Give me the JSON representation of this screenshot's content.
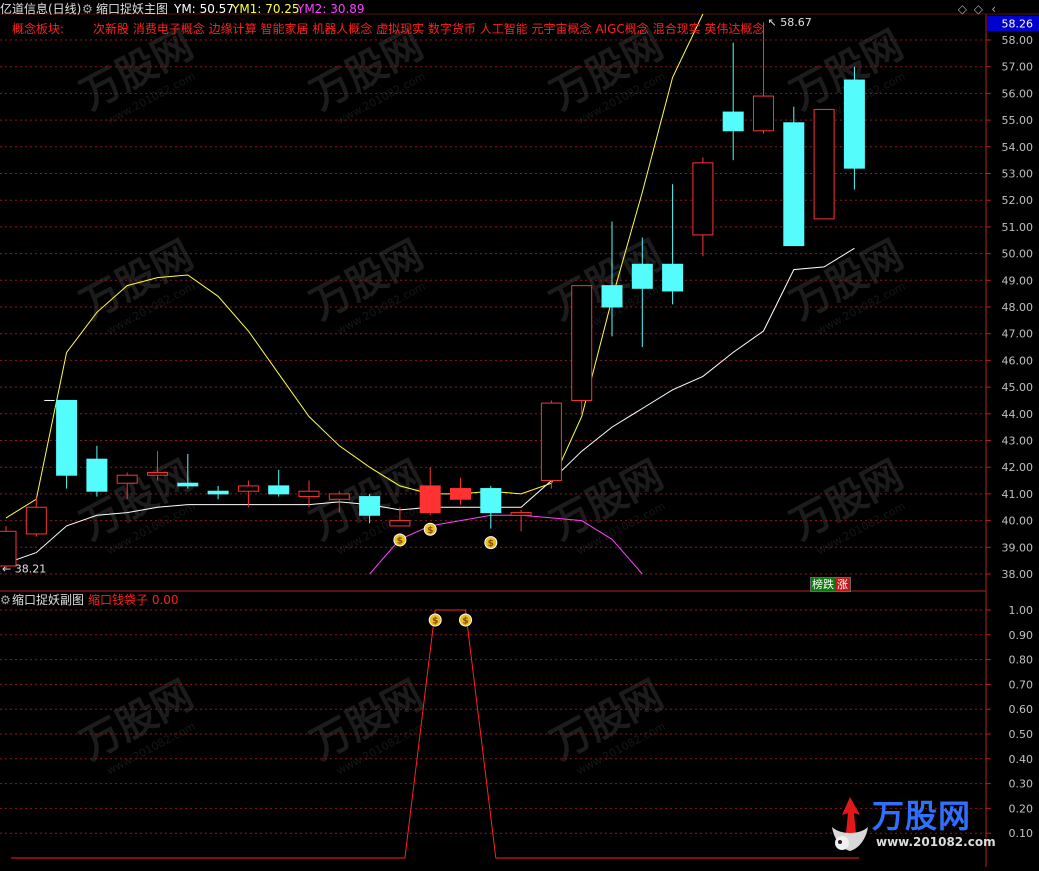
{
  "header": {
    "stock_name": "亿道信息(日线)",
    "main_indicator": "缩口捉妖主图",
    "ym_label": "YM:",
    "ym_value": "50.57",
    "ym1_label": "YM1:",
    "ym1_value": "70.25",
    "ym2_label": "YM2:",
    "ym2_value": "30.89",
    "concept_label": "概念板块:",
    "concepts": "次新股 消费电子概念 边缘计算 智能家居 机器人概念 虚拟现实 数字货币 人工智能 元宇宙概念 AIGC概念 混合现实 英伟达概念"
  },
  "sub_header": {
    "indicator": "缩口捉妖副图",
    "series_label": "缩口钱袋子",
    "series_value": "0.00"
  },
  "badge": {
    "left": "榜跌",
    "right": "涨"
  },
  "watermark": {
    "brand": "万股网",
    "url": "www.201082.com"
  },
  "colors": {
    "background": "#000000",
    "up": "#ff3232",
    "down": "#54fcfc",
    "ym": "#ffffff",
    "ym1": "#ffff40",
    "ym2": "#ff40ff",
    "grid": "#8b1a1a",
    "axis_text": "#c0c0c0",
    "current_price_box": "#0000cc"
  },
  "chart_data": [
    {
      "type": "candlestick",
      "title": "缩口捉妖主图",
      "y_ticks": [
        38,
        39,
        40,
        41,
        42,
        43,
        44,
        45,
        46,
        47,
        48,
        49,
        50,
        51,
        52,
        53,
        54,
        55,
        56,
        57,
        58
      ],
      "ylim": [
        37.6,
        58.6
      ],
      "current_price": "58.26",
      "max_label": "58.67",
      "min_label": "38.21",
      "candles": [
        {
          "o": 38.3,
          "c": 39.6,
          "h": 39.8,
          "l": 38.2
        },
        {
          "o": 39.5,
          "c": 40.5,
          "h": 40.9,
          "l": 39.4
        },
        {
          "o": 44.5,
          "c": 41.7,
          "h": 44.5,
          "l": 41.2
        },
        {
          "o": 42.3,
          "c": 41.1,
          "h": 42.8,
          "l": 40.9
        },
        {
          "o": 41.4,
          "c": 41.7,
          "h": 41.8,
          "l": 40.8
        },
        {
          "o": 41.7,
          "c": 41.8,
          "h": 42.6,
          "l": 41.5
        },
        {
          "o": 41.4,
          "c": 41.3,
          "h": 42.5,
          "l": 41.2
        },
        {
          "o": 41.1,
          "c": 41.0,
          "h": 41.3,
          "l": 40.8
        },
        {
          "o": 41.1,
          "c": 41.3,
          "h": 41.5,
          "l": 40.5
        },
        {
          "o": 41.3,
          "c": 41.0,
          "h": 41.9,
          "l": 40.9
        },
        {
          "o": 40.9,
          "c": 41.1,
          "h": 41.5,
          "l": 40.5
        },
        {
          "o": 40.8,
          "c": 41.0,
          "h": 41.1,
          "l": 40.3
        },
        {
          "o": 40.9,
          "c": 40.2,
          "h": 41.0,
          "l": 39.9
        },
        {
          "o": 39.8,
          "c": 40.0,
          "h": 40.5,
          "l": 39.8
        },
        {
          "o": 40.3,
          "c": 41.3,
          "h": 42.0,
          "l": 40.2
        },
        {
          "o": 40.8,
          "c": 41.2,
          "h": 41.6,
          "l": 40.6
        },
        {
          "o": 41.2,
          "c": 40.3,
          "h": 41.3,
          "l": 39.7
        },
        {
          "o": 40.2,
          "c": 40.3,
          "h": 40.4,
          "l": 39.6
        },
        {
          "o": 41.5,
          "c": 44.4,
          "h": 44.5,
          "l": 41.2
        },
        {
          "o": 44.5,
          "c": 48.8,
          "h": 48.8,
          "l": 44.0
        },
        {
          "o": 48.8,
          "c": 48.0,
          "h": 51.2,
          "l": 46.9
        },
        {
          "o": 49.6,
          "c": 48.7,
          "h": 50.6,
          "l": 46.5
        },
        {
          "o": 49.6,
          "c": 48.6,
          "h": 52.6,
          "l": 48.1
        },
        {
          "o": 50.7,
          "c": 53.4,
          "h": 53.6,
          "l": 49.9
        },
        {
          "o": 55.3,
          "c": 54.6,
          "h": 57.9,
          "l": 53.5
        },
        {
          "o": 54.6,
          "c": 55.9,
          "h": 58.67,
          "l": 54.5
        },
        {
          "o": 54.9,
          "c": 50.3,
          "h": 55.5,
          "l": 50.3
        },
        {
          "o": 51.3,
          "c": 55.4,
          "h": 55.4,
          "l": 51.3
        },
        {
          "o": 56.5,
          "c": 53.2,
          "h": 57.0,
          "l": 52.4
        }
      ],
      "lines": {
        "YM": [
          38.4,
          38.8,
          39.8,
          40.2,
          40.3,
          40.5,
          40.6,
          40.6,
          40.6,
          40.6,
          40.6,
          40.7,
          40.6,
          40.4,
          40.5,
          40.5,
          40.5,
          40.5,
          41.5,
          42.6,
          43.5,
          44.2,
          44.9,
          45.4,
          46.3,
          47.1,
          49.4,
          49.5,
          50.2
        ],
        "YM1": [
          40.1,
          40.8,
          46.3,
          47.8,
          48.8,
          49.1,
          49.2,
          48.4,
          47.1,
          45.5,
          43.9,
          42.8,
          42.0,
          41.3,
          41.0,
          41.0,
          41.1,
          41.0,
          41.4,
          43.9,
          48.3,
          52.3,
          56.6,
          61.0,
          null,
          null,
          null,
          null,
          null
        ],
        "YM2": [
          null,
          null,
          null,
          null,
          null,
          null,
          null,
          null,
          null,
          null,
          null,
          null,
          38.0,
          39.3,
          39.8,
          40.0,
          40.2,
          40.2,
          40.1,
          40.0,
          39.3,
          38.0,
          null,
          null,
          null,
          null,
          null,
          null,
          null
        ]
      },
      "signals": [
        13,
        14,
        16
      ]
    },
    {
      "type": "line",
      "title": "缩口捉妖副图",
      "y_ticks": [
        0.1,
        0.2,
        0.3,
        0.4,
        0.5,
        0.6,
        0.7,
        0.8,
        0.9,
        1.0
      ],
      "ylim": [
        0,
        1.06
      ],
      "series": [
        {
          "name": "缩口钱袋子",
          "values": [
            0,
            0,
            0,
            0,
            0,
            0,
            0,
            0,
            0,
            0,
            0,
            0,
            0,
            0,
            1,
            1,
            0,
            0,
            0,
            0,
            0,
            0,
            0,
            0,
            0,
            0,
            0,
            0,
            0
          ]
        }
      ],
      "signals": [
        14,
        15
      ]
    }
  ]
}
